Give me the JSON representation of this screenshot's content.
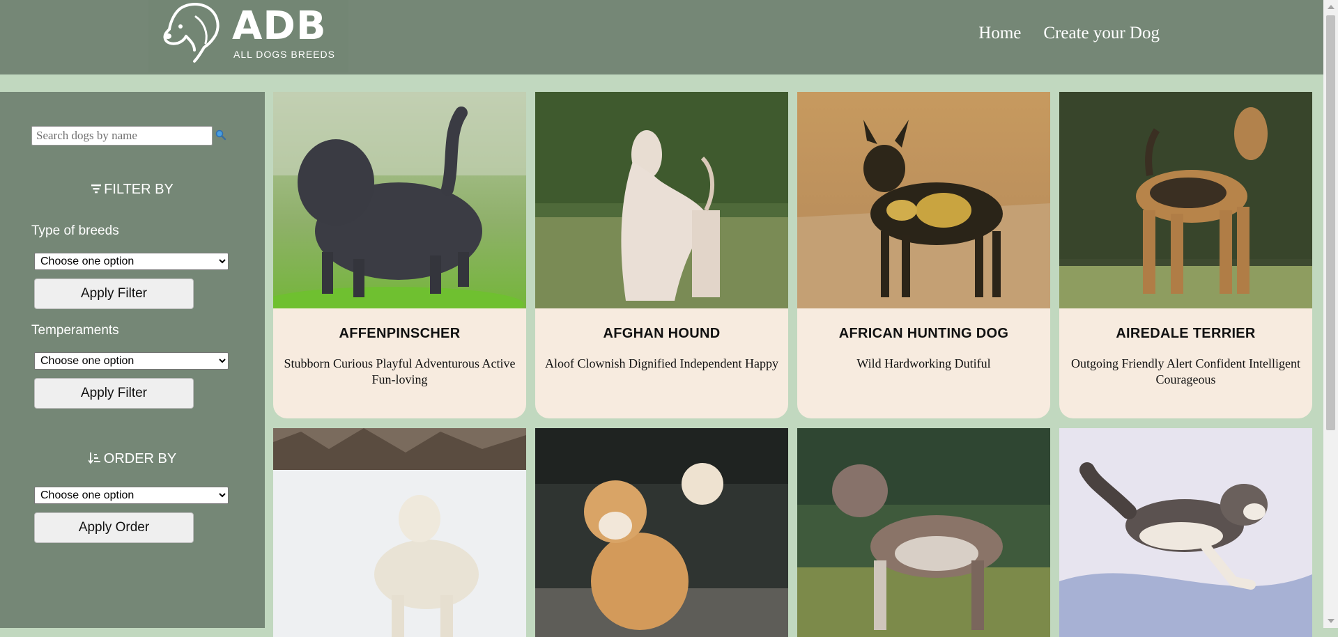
{
  "brand": {
    "logo_main": "ADB",
    "logo_sub": "ALL DOGS BREEDS",
    "logo_icon": "dog-head-icon"
  },
  "nav": {
    "home": "Home",
    "create": "Create your Dog"
  },
  "search": {
    "placeholder": "Search dogs by name",
    "value": "",
    "icon": "search-icon"
  },
  "filter": {
    "title": "FILTER BY",
    "icon": "filter-icon",
    "breeds_label": "Type of breeds",
    "breeds_selected": "Choose one option",
    "temperaments_label": "Temperaments",
    "temperaments_selected": "Choose one option",
    "apply_label": "Apply Filter"
  },
  "order": {
    "title": "ORDER BY",
    "icon": "sort-icon",
    "selected": "Choose one option",
    "apply_label": "Apply Order"
  },
  "cards": [
    {
      "name": "AFFENPINSCHER",
      "temperament": "Stubborn Curious Playful Adventurous Active Fun-loving"
    },
    {
      "name": "AFGHAN HOUND",
      "temperament": "Aloof Clownish Dignified Independent Happy"
    },
    {
      "name": "AFRICAN HUNTING DOG",
      "temperament": "Wild Hardworking Dutiful"
    },
    {
      "name": "AIREDALE TERRIER",
      "temperament": "Outgoing Friendly Alert Confident Intelligent Courageous"
    }
  ],
  "colors": {
    "header": "#758776",
    "background": "#c1d8bf",
    "card": "#f7ebdf",
    "text_light": "#ffffff"
  }
}
